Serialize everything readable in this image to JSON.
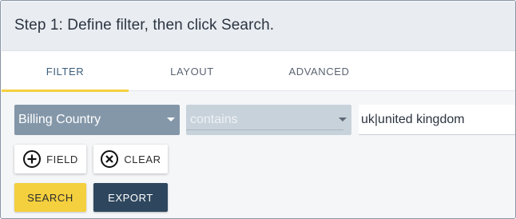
{
  "header": {
    "title": "Step 1: Define filter, then click Search."
  },
  "tabs": [
    {
      "label": "FILTER",
      "active": true
    },
    {
      "label": "LAYOUT",
      "active": false
    },
    {
      "label": "ADVANCED",
      "active": false
    }
  ],
  "filter": {
    "field_select": {
      "value": "Billing Country",
      "icon": "caret-down-icon"
    },
    "operator_select": {
      "value": "contains",
      "icon": "caret-down-icon"
    },
    "value_input": {
      "value": "uk|united kingdom"
    }
  },
  "buttons": {
    "field": {
      "label": "FIELD",
      "icon": "plus-circle-icon"
    },
    "clear": {
      "label": "CLEAR",
      "icon": "x-circle-icon"
    },
    "search": {
      "label": "SEARCH"
    },
    "export": {
      "label": "EXPORT"
    }
  },
  "colors": {
    "accent": "#f4d03f",
    "field_select_bg": "#8497a9",
    "export_bg": "#2e475e"
  }
}
